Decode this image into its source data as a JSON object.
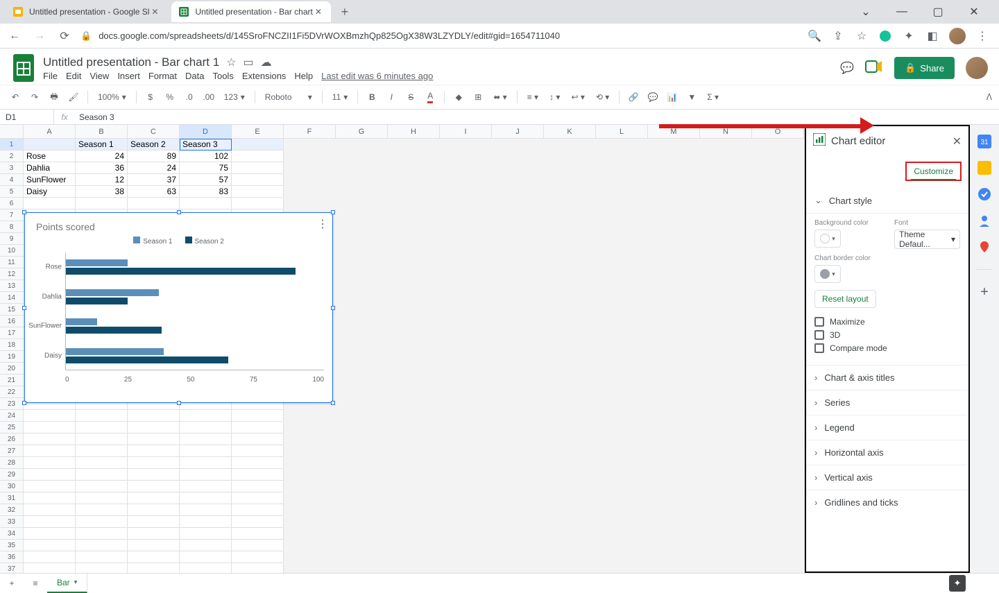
{
  "browser": {
    "tabs": [
      {
        "title": "Untitled presentation - Google Sl",
        "icon_color": "#f5b400"
      },
      {
        "title": "Untitled presentation - Bar chart",
        "icon_color": "#188038"
      }
    ],
    "new_tab": "+",
    "url": "docs.google.com/spreadsheets/d/145SroFNCZII1Fi5DVrWOXBmzhQp825OgX38W3LZYDLY/edit#gid=1654711040"
  },
  "doc": {
    "title": "Untitled presentation - Bar chart 1",
    "menus": [
      "File",
      "Edit",
      "View",
      "Insert",
      "Format",
      "Data",
      "Tools",
      "Extensions",
      "Help"
    ],
    "last_edit": "Last edit was 6 minutes ago",
    "share": "Share"
  },
  "toolbar": {
    "zoom": "100%",
    "currency": "$",
    "percent": "%",
    "dec_dec": ".0",
    "dec_inc": ".00",
    "fmt": "123",
    "font": "Roboto",
    "font_size": "11"
  },
  "fxbar": {
    "cell": "D1",
    "fx": "fx",
    "value": "Season 3"
  },
  "columns": [
    "A",
    "B",
    "C",
    "D",
    "E",
    "F",
    "G",
    "H",
    "I",
    "J",
    "K",
    "L",
    "M",
    "N",
    "O"
  ],
  "spreadsheet": {
    "headers": [
      "",
      "Season 1",
      "Season 2",
      "Season 3"
    ],
    "rows": [
      {
        "label": "Rose",
        "v": [
          24,
          89,
          102
        ]
      },
      {
        "label": "Dahlia",
        "v": [
          36,
          24,
          75
        ]
      },
      {
        "label": "SunFlower",
        "v": [
          12,
          37,
          57
        ]
      },
      {
        "label": "Daisy",
        "v": [
          38,
          63,
          83
        ]
      }
    ]
  },
  "chart_data": {
    "type": "bar",
    "title": "Points scored",
    "orientation": "horizontal",
    "categories": [
      "Rose",
      "Dahlia",
      "SunFlower",
      "Daisy"
    ],
    "series": [
      {
        "name": "Season 1",
        "color": "#5a8fba",
        "values": [
          24,
          36,
          12,
          38
        ]
      },
      {
        "name": "Season 2",
        "color": "#0f4c6b",
        "values": [
          89,
          24,
          37,
          63
        ]
      }
    ],
    "xlim": [
      0,
      100
    ],
    "xticks": [
      0,
      25,
      50,
      75,
      100
    ]
  },
  "editor": {
    "title": "Chart editor",
    "tab_customize": "Customize",
    "sections": {
      "chart_style": "Chart style",
      "bg_label": "Background color",
      "font_label": "Font",
      "font_value": "Theme Defaul...",
      "border_label": "Chart border color",
      "reset": "Reset layout",
      "maximize": "Maximize",
      "three_d": "3D",
      "compare": "Compare mode",
      "collapsed": [
        "Chart & axis titles",
        "Series",
        "Legend",
        "Horizontal axis",
        "Vertical axis",
        "Gridlines and ticks"
      ]
    }
  },
  "sheetbar": {
    "tab": "Bar"
  }
}
